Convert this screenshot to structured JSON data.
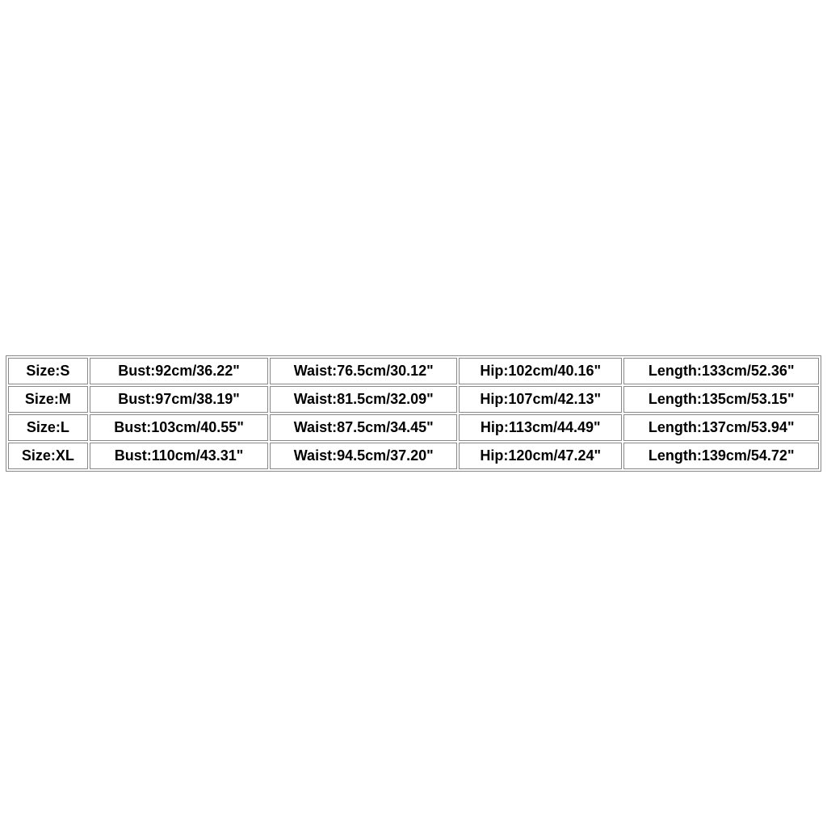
{
  "size_chart": {
    "rows": [
      {
        "size": "Size:S",
        "bust": "Bust:92cm/36.22\"",
        "waist": "Waist:76.5cm/30.12\"",
        "hip": "Hip:102cm/40.16\"",
        "length": "Length:133cm/52.36\""
      },
      {
        "size": "Size:M",
        "bust": "Bust:97cm/38.19\"",
        "waist": "Waist:81.5cm/32.09\"",
        "hip": "Hip:107cm/42.13\"",
        "length": "Length:135cm/53.15\""
      },
      {
        "size": "Size:L",
        "bust": "Bust:103cm/40.55\"",
        "waist": "Waist:87.5cm/34.45\"",
        "hip": "Hip:113cm/44.49\"",
        "length": "Length:137cm/53.94\""
      },
      {
        "size": "Size:XL",
        "bust": "Bust:110cm/43.31\"",
        "waist": "Waist:94.5cm/37.20\"",
        "hip": "Hip:120cm/47.24\"",
        "length": "Length:139cm/54.72\""
      }
    ]
  }
}
